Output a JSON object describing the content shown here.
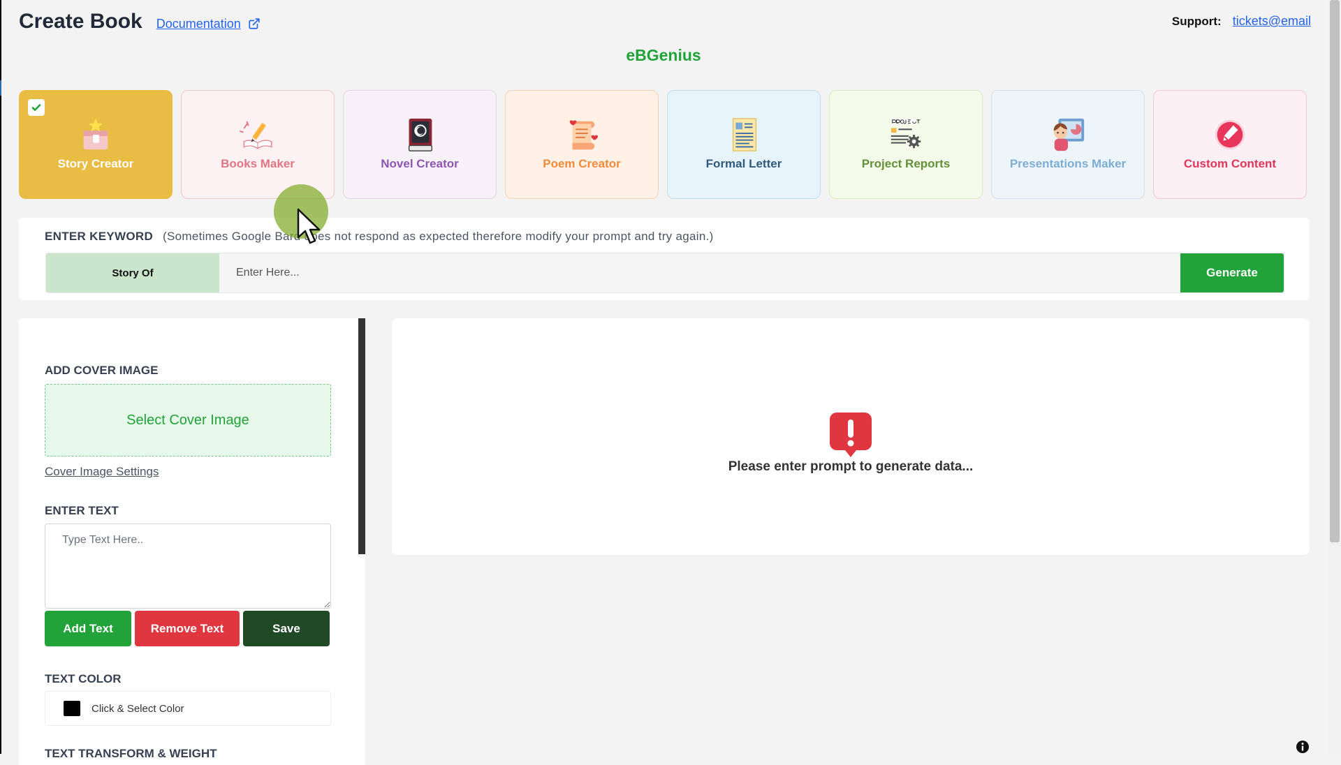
{
  "header": {
    "title": "Create Book",
    "doc_link": "Documentation",
    "support_label": "Support:",
    "support_email": "tickets@email"
  },
  "brand": "eBGenius",
  "tools": [
    {
      "label": "Story Creator",
      "icon": "gift-box-icon",
      "selected": true,
      "bg": "#e9bc43",
      "border": "#e9bc43",
      "color": "#ffffff"
    },
    {
      "label": "Books Maker",
      "icon": "book-pencil-icon",
      "selected": false,
      "bg": "#fdf2f3",
      "border": "#f3c6cb",
      "color": "#e07684"
    },
    {
      "label": "Novel Creator",
      "icon": "novel-book-icon",
      "selected": false,
      "bg": "#f7f1f8",
      "border": "#e2d5e6",
      "color": "#8e56b0"
    },
    {
      "label": "Poem Creator",
      "icon": "scroll-hearts-icon",
      "selected": false,
      "bg": "#fff1e6",
      "border": "#f6d2b4",
      "color": "#ef8a3b"
    },
    {
      "label": "Formal Letter",
      "icon": "letter-document-icon",
      "selected": false,
      "bg": "#e6f3fb",
      "border": "#c1def0",
      "color": "#2f5a7c"
    },
    {
      "label": "Project Reports",
      "icon": "project-gear-icon",
      "selected": false,
      "bg": "#f4fae9",
      "border": "#d8ecc0",
      "color": "#64903a"
    },
    {
      "label": "Presentations Maker",
      "icon": "presenter-icon",
      "selected": false,
      "bg": "#eef5fa",
      "border": "#d0e2ef",
      "color": "#7eadd3"
    },
    {
      "label": "Custom Content",
      "icon": "custom-pen-icon",
      "selected": false,
      "bg": "#fdf0f4",
      "border": "#f4c8d5",
      "color": "#e0365b"
    }
  ],
  "keyword": {
    "heading": "ENTER KEYWORD",
    "note": "(Sometimes Google Bard does not respond as expected therefore modify your prompt and try again.)",
    "prefix": "Story Of",
    "placeholder": "Enter Here...",
    "generate": "Generate"
  },
  "editor": {
    "cover_heading": "ADD COVER IMAGE",
    "select_cover": "Select Cover Image",
    "cover_settings": "Cover Image Settings",
    "text_heading": "ENTER TEXT",
    "text_placeholder": "Type Text Here..",
    "add_text": "Add Text",
    "remove_text": "Remove Text",
    "save": "Save",
    "color_heading": "TEXT COLOR",
    "color_label": "Click & Select Color",
    "current_color": "#000000",
    "transform_heading": "TEXT TRANSFORM & WEIGHT"
  },
  "output": {
    "empty_message": "Please enter prompt to generate data..."
  },
  "colors": {
    "accent_green": "#22a33a",
    "danger_red": "#e0363f",
    "dark_green": "#1f4a25",
    "link_blue": "#2563eb"
  }
}
